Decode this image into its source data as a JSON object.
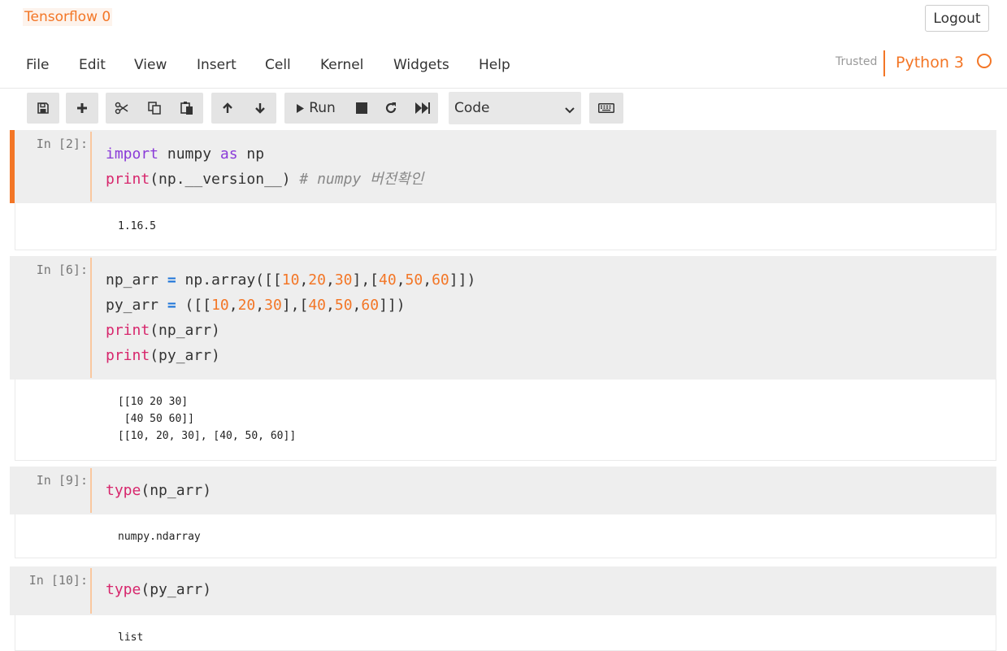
{
  "notebook": {
    "title": "Tensorflow 0"
  },
  "header": {
    "logout_label": "Logout",
    "trusted_label": "Trusted",
    "kernel_name": "Python 3"
  },
  "menu": {
    "items": [
      "File",
      "Edit",
      "View",
      "Insert",
      "Cell",
      "Kernel",
      "Widgets",
      "Help"
    ]
  },
  "toolbar": {
    "run_label": "Run",
    "cell_type": "Code",
    "icons": [
      "save-icon",
      "plus-icon",
      "cut-icon",
      "copy-icon",
      "paste-icon",
      "arrow-up-icon",
      "arrow-down-icon",
      "stop-icon",
      "restart-icon",
      "fast-forward-icon",
      "keyboard-icon"
    ]
  },
  "colors": {
    "accent": "#f37626",
    "keyword": "#8a3bd8",
    "builtin": "#d7266c",
    "number": "#f37626",
    "operator": "#1c74d9",
    "comment": "#888888",
    "cell_bg": "#eeeeee"
  },
  "cells": [
    {
      "prompt": "In [2]:",
      "code": [
        [
          {
            "t": "import",
            "c": "kw"
          },
          {
            "t": " numpy "
          },
          {
            "t": "as",
            "c": "kw"
          },
          {
            "t": " np"
          }
        ],
        [
          {
            "t": "print",
            "c": "bi"
          },
          {
            "t": "(np.__version__) "
          },
          {
            "t": "# numpy 버전확인",
            "c": "cm"
          }
        ]
      ],
      "output": [
        "1.16.5"
      ]
    },
    {
      "prompt": "In [6]:",
      "code": [
        [
          {
            "t": "np_arr "
          },
          {
            "t": "=",
            "c": "op"
          },
          {
            "t": " np.array([["
          },
          {
            "t": "10",
            "c": "num"
          },
          {
            "t": ","
          },
          {
            "t": "20",
            "c": "num"
          },
          {
            "t": ","
          },
          {
            "t": "30",
            "c": "num"
          },
          {
            "t": "],["
          },
          {
            "t": "40",
            "c": "num"
          },
          {
            "t": ","
          },
          {
            "t": "50",
            "c": "num"
          },
          {
            "t": ","
          },
          {
            "t": "60",
            "c": "num"
          },
          {
            "t": "]])"
          }
        ],
        [
          {
            "t": "py_arr "
          },
          {
            "t": "=",
            "c": "op"
          },
          {
            "t": " ([["
          },
          {
            "t": "10",
            "c": "num"
          },
          {
            "t": ","
          },
          {
            "t": "20",
            "c": "num"
          },
          {
            "t": ","
          },
          {
            "t": "30",
            "c": "num"
          },
          {
            "t": "],["
          },
          {
            "t": "40",
            "c": "num"
          },
          {
            "t": ","
          },
          {
            "t": "50",
            "c": "num"
          },
          {
            "t": ","
          },
          {
            "t": "60",
            "c": "num"
          },
          {
            "t": "]])"
          }
        ],
        [
          {
            "t": "print",
            "c": "bi"
          },
          {
            "t": "(np_arr)"
          }
        ],
        [
          {
            "t": "print",
            "c": "bi"
          },
          {
            "t": "(py_arr)"
          }
        ]
      ],
      "output": [
        "[[10 20 30]",
        " [40 50 60]]",
        "[[10, 20, 30], [40, 50, 60]]"
      ]
    },
    {
      "prompt": "In [9]:",
      "code": [
        [
          {
            "t": "type",
            "c": "bi"
          },
          {
            "t": "(np_arr)"
          }
        ]
      ],
      "output": [
        "numpy.ndarray"
      ]
    },
    {
      "prompt": "In [10]:",
      "code": [
        [
          {
            "t": "type",
            "c": "bi"
          },
          {
            "t": "(py_arr)"
          }
        ]
      ],
      "output": [
        "list"
      ]
    }
  ]
}
